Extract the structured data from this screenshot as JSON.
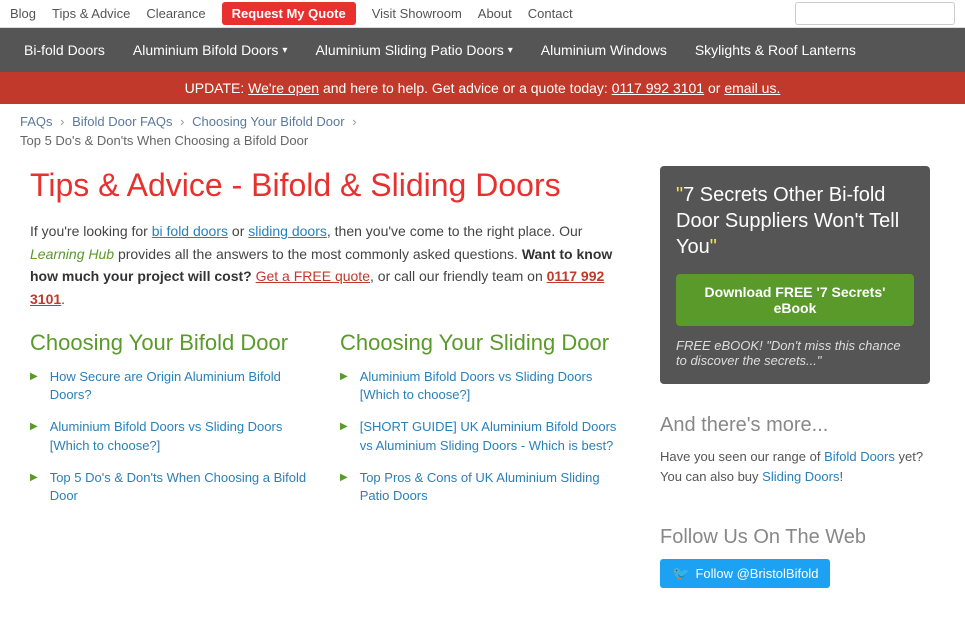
{
  "topNav": {
    "links": [
      {
        "label": "Blog",
        "href": "#"
      },
      {
        "label": "Tips & Advice",
        "href": "#"
      },
      {
        "label": "Clearance",
        "href": "#"
      },
      {
        "label": "Request My Quote",
        "href": "#",
        "highlight": true
      },
      {
        "label": "Visit Showroom",
        "href": "#"
      },
      {
        "label": "About",
        "href": "#"
      },
      {
        "label": "Contact",
        "href": "#"
      }
    ],
    "searchPlaceholder": ""
  },
  "mainNav": {
    "links": [
      {
        "label": "Bi-fold Doors",
        "href": "#",
        "dropdown": false
      },
      {
        "label": "Aluminium Bifold Doors",
        "href": "#",
        "dropdown": true
      },
      {
        "label": "Aluminium Sliding Patio Doors",
        "href": "#",
        "dropdown": true
      },
      {
        "label": "Aluminium Windows",
        "href": "#",
        "dropdown": false
      },
      {
        "label": "Skylights & Roof Lanterns",
        "href": "#",
        "dropdown": false
      }
    ]
  },
  "alertBar": {
    "text": "UPDATE: ",
    "linkText": "We're open",
    "afterLink": " and here to help. Get advice or a quote today: ",
    "phone": "0117 992 3101",
    "or": " or ",
    "emailText": "email us."
  },
  "breadcrumb": {
    "items": [
      {
        "label": "FAQs",
        "href": "#"
      },
      {
        "label": "Bifold Door FAQs",
        "href": "#"
      },
      {
        "label": "Choosing Your Bifold Door",
        "href": "#"
      }
    ],
    "current": "Top 5 Do's & Don'ts When Choosing a Bifold Door"
  },
  "mainContent": {
    "title": "Tips & Advice - Bifold & Sliding Doors",
    "introText": {
      "part1": "If you're looking for ",
      "link1": "bi fold doors",
      "part2": " or ",
      "link2": "sliding doors",
      "part3": ", then you've come to the right place. Our ",
      "learningHub": "Learning Hub",
      "part4": " provides all the answers to the most commonly asked questions. ",
      "bold": "Want to know how much your project will cost?",
      "part5": " ",
      "quoteLink": "Get a FREE quote",
      "part6": ", or call our friendly team on ",
      "phone": "0117 992 3101",
      "end": "."
    },
    "col1": {
      "title": "Choosing Your Bifold Door",
      "items": [
        {
          "text": "How Secure are Origin Aluminium Bifold Doors?",
          "href": "#"
        },
        {
          "text": "Aluminium Bifold Doors vs Sliding Doors [Which to choose?]",
          "href": "#"
        },
        {
          "text": "Top 5 Do's & Don'ts When Choosing a Bifold Door",
          "href": "#"
        }
      ]
    },
    "col2": {
      "title": "Choosing Your Sliding Door",
      "items": [
        {
          "text": "Aluminium Bifold Doors vs Sliding Doors [Which to choose?]",
          "href": "#"
        },
        {
          "text": "[SHORT GUIDE] UK Aluminium Bifold Doors vs Aluminium Sliding Doors - Which is best?",
          "href": "#"
        },
        {
          "text": "Top Pros & Cons of UK Aluminium Sliding Patio Doors",
          "href": "#"
        }
      ]
    }
  },
  "sidebar": {
    "ebookBox": {
      "quoteOpen": "“",
      "title": "7 Secrets Other Bi-fold Door Suppliers Won't Tell You",
      "quoteClose": "”",
      "buttonLabel": "Download FREE '7 Secrets' eBook",
      "subText": "FREE eBOOK! \"Don't miss this chance to discover the secrets...\""
    },
    "moreSection": {
      "title": "And there's more...",
      "part1": "Have you seen our range of ",
      "link1": "Bifold Doors",
      "part2": " yet? You can also buy ",
      "link2": "Sliding Doors",
      "part3": "!"
    },
    "followSection": {
      "title": "Follow Us On The Web",
      "twitterLabel": "@BristolBifold",
      "twitterButtonText": "Follow @BristolBifold"
    }
  }
}
